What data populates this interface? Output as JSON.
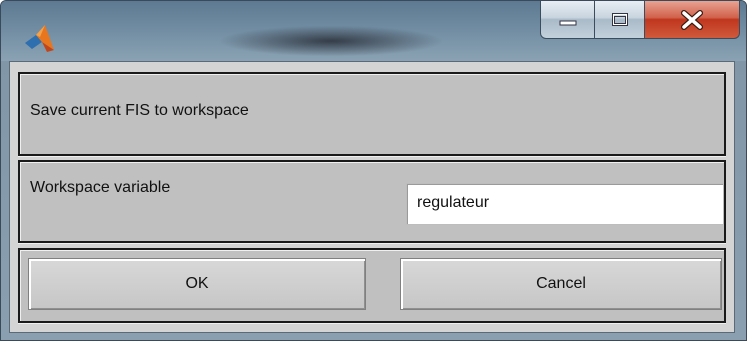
{
  "window": {
    "caption_buttons": {
      "minimize": "minimize-icon",
      "maximize": "maximize-icon",
      "close": "close-icon"
    }
  },
  "dialog": {
    "title_text": "Save current FIS to workspace",
    "workspace_label": "Workspace variable",
    "workspace_value": "regulateur",
    "ok_label": "OK",
    "cancel_label": "Cancel"
  },
  "colors": {
    "dialog_bg": "#c0c0c0",
    "close_button": "#c0361e"
  }
}
